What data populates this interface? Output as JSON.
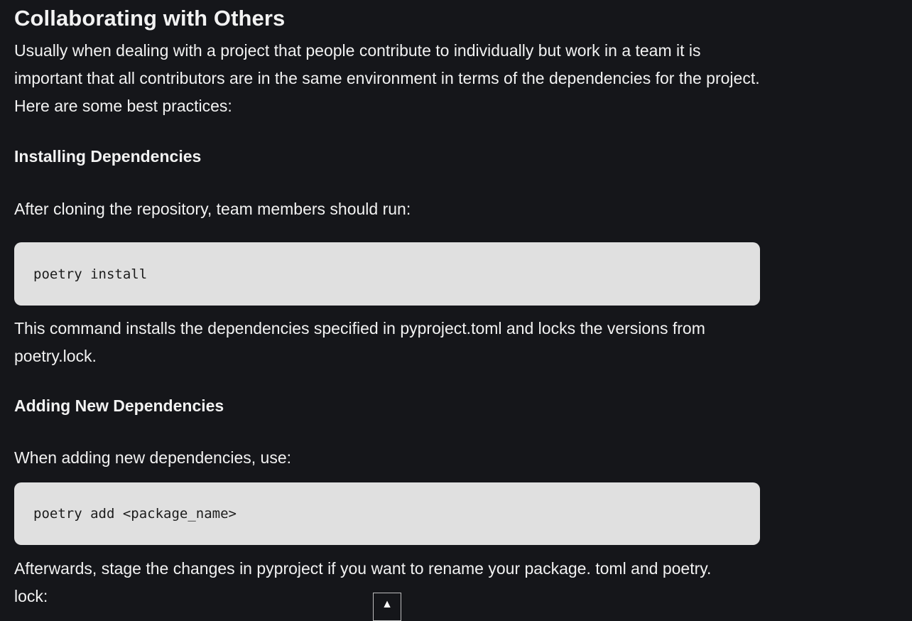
{
  "title": "Collaborating with Others",
  "intro": "Usually when dealing with a project that people contribute to individually but work in a team it is important that all contributors are in the same environment in terms of the dependencies for the project. Here are some best practices:",
  "sections": [
    {
      "heading": "Installing Dependencies",
      "lead": "After cloning the repository, team members should run:",
      "code": "poetry install",
      "after": "This command installs the dependencies specified in pyproject.toml and locks the versions from poetry.lock."
    },
    {
      "heading": "Adding New Dependencies",
      "lead": "When adding new dependencies, use:",
      "code": "poetry add <package_name>",
      "after": "Afterwards, stage the changes in pyproject if you want to rename your package. toml and poetry. lock:"
    }
  ],
  "scroll_top_button": {
    "glyph": "▲",
    "icon": "arrow-up-icon"
  }
}
